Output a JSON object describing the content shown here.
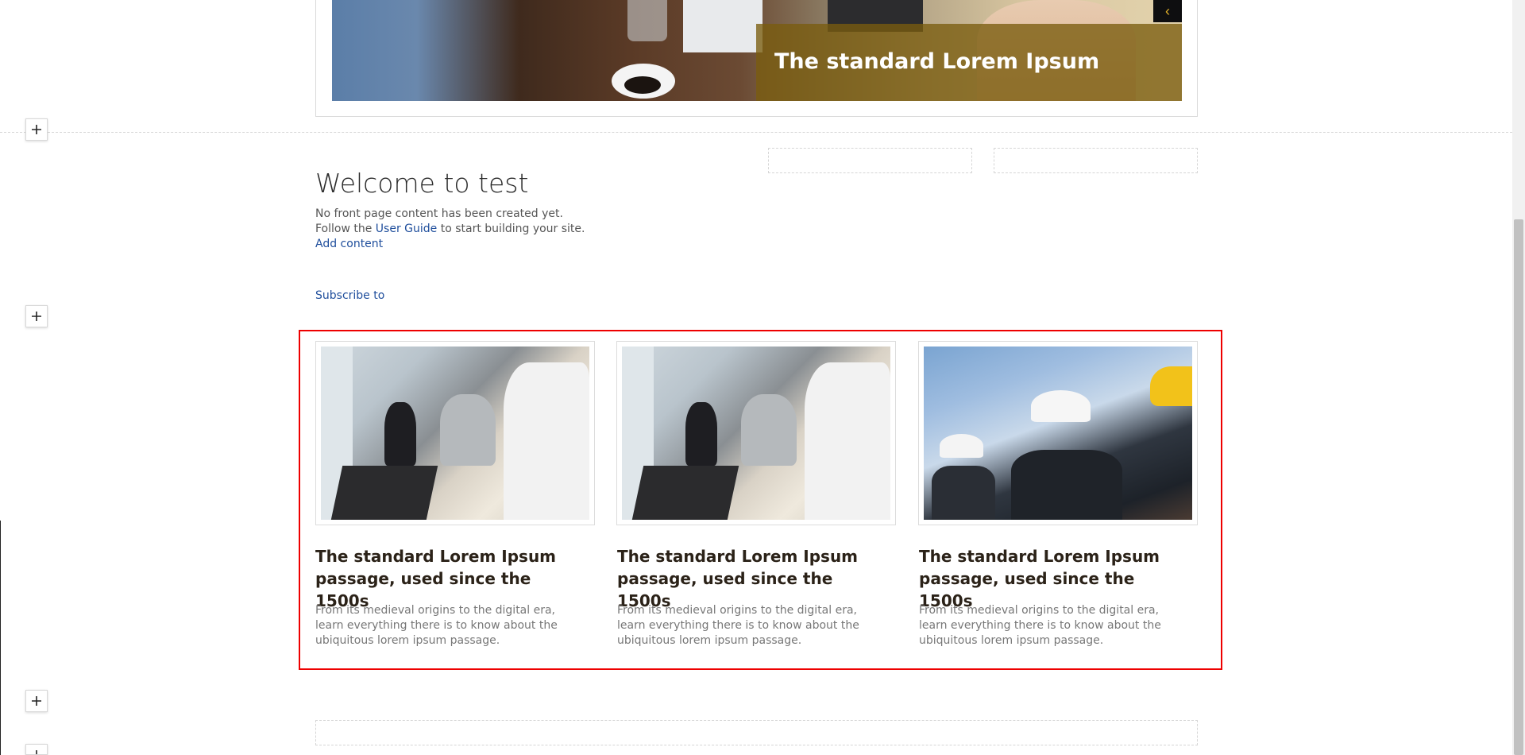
{
  "slider": {
    "title": "The standard Lorem Ipsum",
    "prev_icon": "chevron-left-icon"
  },
  "welcome": {
    "title": "Welcome to test",
    "line1": "No front page content has been created yet.",
    "line2_prefix": "Follow the",
    "line2_link": "User Guide",
    "line2_suffix": "to start building your site.",
    "add_content": "Add content",
    "subscribe": "Subscribe to"
  },
  "cards": [
    {
      "image": "office-team-photo",
      "title": "The standard Lorem Ipsum passage, used since the 1500s",
      "description": "From its medieval origins to the digital era, learn everything there is to know about the ubiquitous lorem ipsum passage."
    },
    {
      "image": "office-team-photo",
      "title": "The standard Lorem Ipsum passage, used since the 1500s",
      "description": "From its medieval origins to the digital era, learn everything there is to know about the ubiquitous lorem ipsum passage."
    },
    {
      "image": "construction-team-photo",
      "title": "The standard Lorem Ipsum passage, used since the 1500s",
      "description": "From its medieval origins to the digital era, learn everything there is to know about the ubiquitous lorem ipsum passage."
    }
  ],
  "controls": {
    "add_section_icon": "plus-icon"
  },
  "colors": {
    "link": "#1f4e9c",
    "highlight": "#ee0000",
    "caption_bg": "#7a5c0e"
  }
}
